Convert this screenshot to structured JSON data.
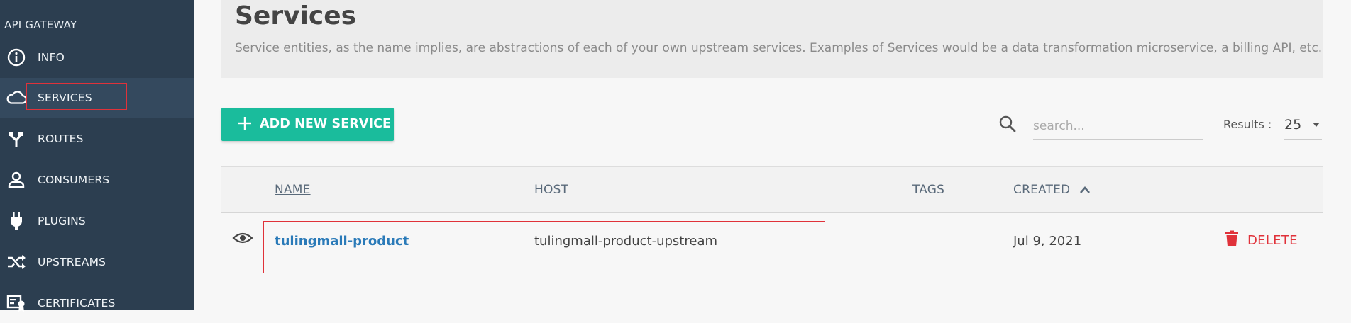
{
  "sidebar": {
    "section_title": "API GATEWAY",
    "items": [
      {
        "label": "INFO",
        "icon": "info-icon",
        "active": false
      },
      {
        "label": "SERVICES",
        "icon": "cloud-icon",
        "active": true
      },
      {
        "label": "ROUTES",
        "icon": "route-fork-icon",
        "active": false
      },
      {
        "label": "CONSUMERS",
        "icon": "user-icon",
        "active": false
      },
      {
        "label": "PLUGINS",
        "icon": "plug-icon",
        "active": false
      },
      {
        "label": "UPSTREAMS",
        "icon": "shuffle-icon",
        "active": false
      },
      {
        "label": "CERTIFICATES",
        "icon": "certificate-icon",
        "active": false
      }
    ]
  },
  "header": {
    "title": "Services",
    "description": "Service entities, as the name implies, are abstractions of each of your own upstream services. Examples of Services would be a data transformation microservice, a billing API, etc."
  },
  "toolbar": {
    "add_label": "ADD NEW SERVICE",
    "search_placeholder": "search...",
    "results_label": "Results :",
    "results_value": "25"
  },
  "table": {
    "columns": {
      "name": "NAME",
      "host": "HOST",
      "tags": "TAGS",
      "created": "CREATED"
    },
    "rows": [
      {
        "name": "tulingmall-product",
        "host": "tulingmall-product-upstream",
        "tags": "",
        "created": "Jul 9, 2021",
        "delete_label": "DELETE"
      }
    ]
  },
  "colors": {
    "sidebar_bg": "#2c3e50",
    "accent": "#1abc9c",
    "danger": "#e0323a",
    "link": "#2a7ab8"
  }
}
